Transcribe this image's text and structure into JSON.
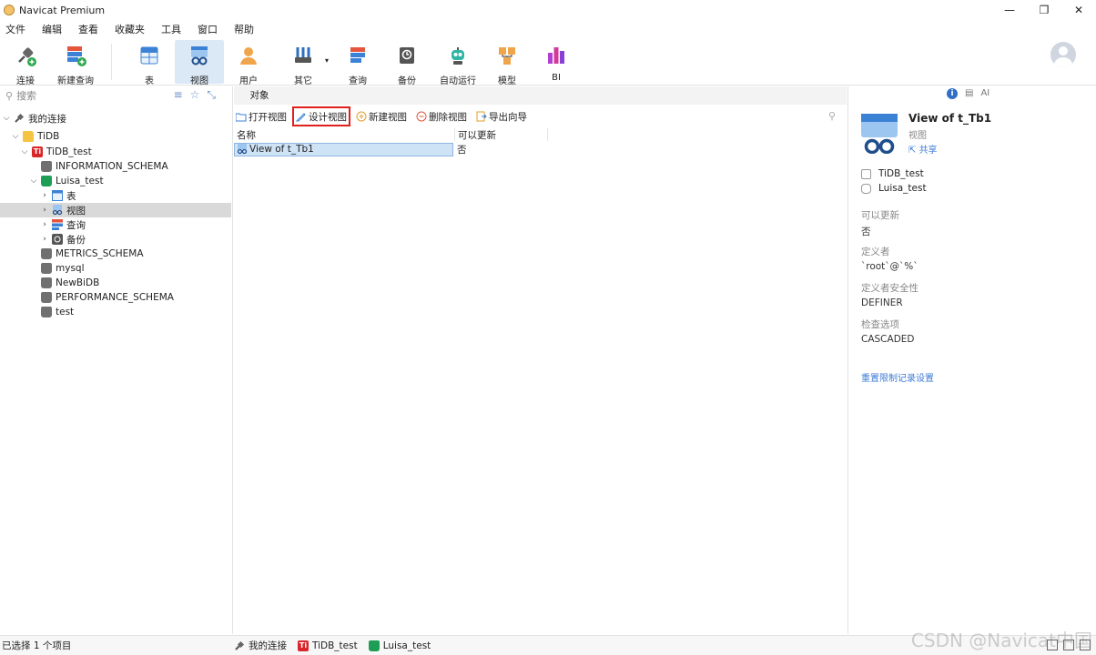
{
  "window": {
    "title": "Navicat Premium",
    "controls": [
      "—",
      "❐",
      "✕"
    ]
  },
  "menu": [
    "文件",
    "编辑",
    "查看",
    "收藏夹",
    "工具",
    "窗口",
    "帮助"
  ],
  "toolbar": {
    "connect": "连接",
    "new_query": "新建查询",
    "table": "表",
    "view": "视图",
    "user": "用户",
    "other": "其它",
    "query": "查询",
    "backup": "备份",
    "automation": "自动运行",
    "model": "模型",
    "bi": "BI"
  },
  "sidebar": {
    "search_placeholder": "搜索",
    "tree": {
      "my_connections": "我的连接",
      "tidb": "TiDB",
      "tidb_test": "TiDB_test",
      "information_schema": "INFORMATION_SCHEMA",
      "luisa_test": "Luisa_test",
      "tables": "表",
      "views": "视图",
      "queries": "查询",
      "backups": "备份",
      "metrics_schema": "METRICS_SCHEMA",
      "mysql": "mysql",
      "newbidb": "NewBiDB",
      "performance_schema": "PERFORMANCE_SCHEMA",
      "test": "test"
    }
  },
  "main": {
    "tab": "对象",
    "actions": {
      "open": "打开视图",
      "design": "设计视图",
      "new": "新建视图",
      "delete": "删除视图",
      "export": "导出向导"
    },
    "columns": {
      "name": "名称",
      "updatable": "可以更新"
    },
    "rows": [
      {
        "name": "View of t_Tb1",
        "updatable": "否"
      }
    ]
  },
  "info": {
    "name": "View of t_Tb1",
    "type": "视图",
    "share": "共享",
    "connection": "TiDB_test",
    "database": "Luisa_test",
    "props": [
      {
        "k": "可以更新",
        "v": "否"
      },
      {
        "k": "定义者",
        "v": "`root`@`%`"
      },
      {
        "k": "定义者安全性",
        "v": "DEFINER"
      },
      {
        "k": "检查选项",
        "v": "CASCADED"
      }
    ],
    "reset_link": "重置限制记录设置"
  },
  "status": {
    "selection": "已选择 1 个项目",
    "crumbs": [
      "我的连接",
      "TiDB_test",
      "Luisa_test"
    ]
  },
  "watermark": "CSDN @Navicat中国",
  "colors": {
    "accent": "#3e7bd6",
    "highlight_border": "#e0201c",
    "selected_row": "#cfe3f7"
  }
}
